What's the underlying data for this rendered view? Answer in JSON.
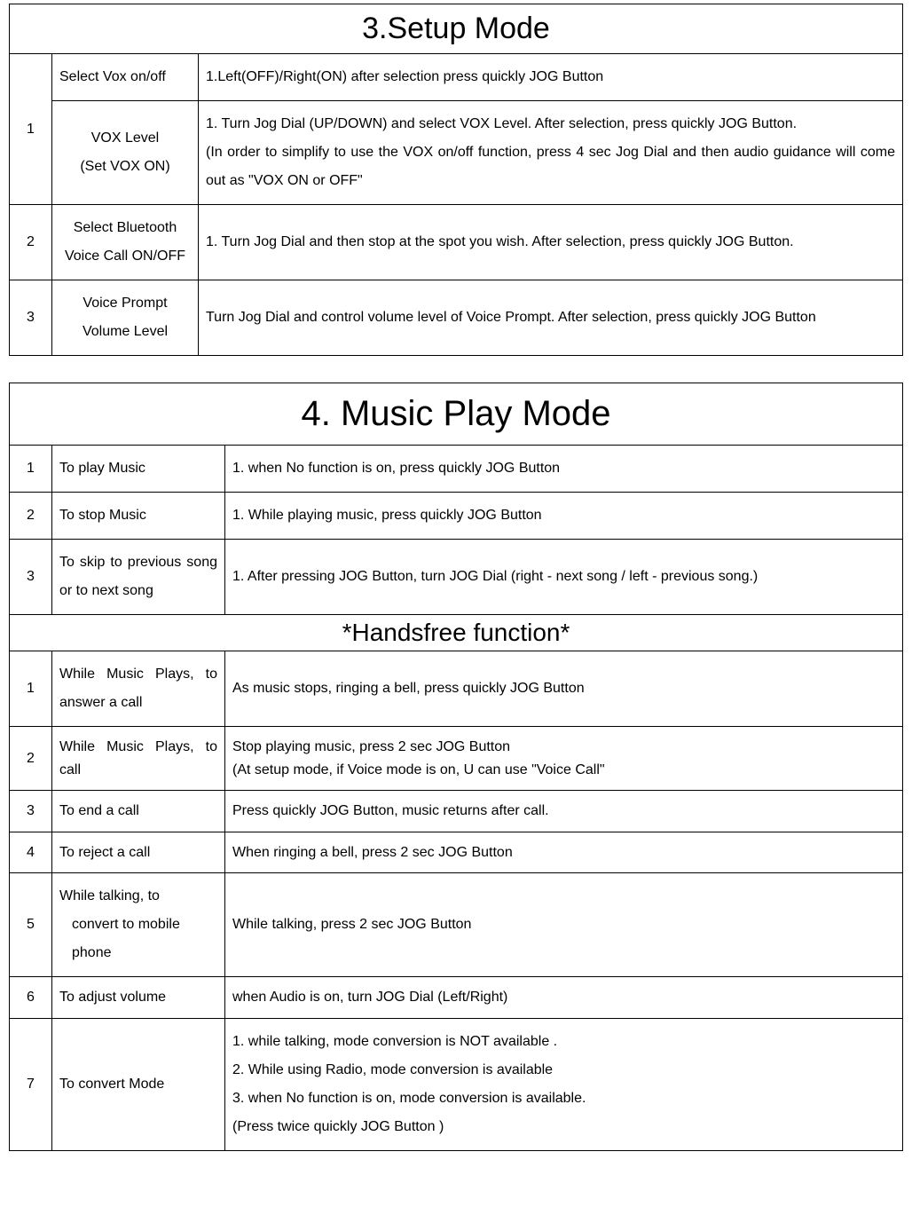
{
  "section3": {
    "title": "3.Setup Mode",
    "rows": [
      {
        "num": "1",
        "func1": "Select Vox on/off",
        "desc1": "1.Left(OFF)/Right(ON) after selection press quickly JOG Button",
        "func2_line1": "VOX Level",
        "func2_line2": "(Set VOX ON)",
        "desc2_line1": "1. Turn Jog Dial (UP/DOWN) and select VOX Level. After selection, press quickly JOG Button.",
        "desc2_line2": "(In order to simplify to use the VOX on/off function, press 4 sec Jog Dial and then audio guidance will come out as \"VOX ON or OFF\""
      },
      {
        "num": "2",
        "func_line1": "Select Bluetooth",
        "func_line2": "Voice Call ON/OFF",
        "desc": "1. Turn Jog Dial and then stop at the spot you wish. After selection, press quickly JOG Button."
      },
      {
        "num": "3",
        "func_line1": "Voice Prompt",
        "func_line2": "Volume Level",
        "desc": "Turn Jog Dial and control volume level of Voice Prompt. After selection, press quickly JOG Button"
      }
    ]
  },
  "section4": {
    "title": "4. Music Play Mode",
    "rows": [
      {
        "num": "1",
        "func": "To play Music",
        "desc": "1. when No function is on, press quickly JOG Button"
      },
      {
        "num": "2",
        "func": "To stop Music",
        "desc": "1. While playing music, press quickly JOG Button"
      },
      {
        "num": "3",
        "func": "To skip to previous song or to next song",
        "desc": "1. After pressing JOG Button, turn JOG Dial (right - next song / left - previous song.)"
      }
    ],
    "handsfree_title": "*Handsfree function*",
    "hf_rows": [
      {
        "num": "1",
        "func": "While Music Plays, to answer a call",
        "desc": "As music stops, ringing a bell, press quickly JOG Button"
      },
      {
        "num": "2",
        "func": "While Music Plays, to call",
        "desc_line1": "Stop playing music, press 2 sec JOG Button",
        "desc_line2": "(At setup mode, if Voice mode is on, U can use \"Voice Call\""
      },
      {
        "num": "3",
        "func": "To end a call",
        "desc": "Press quickly JOG Button, music returns after call."
      },
      {
        "num": "4",
        "func": "To reject a call",
        "desc": "When ringing a bell, press 2 sec JOG Button"
      },
      {
        "num": "5",
        "func_line1": "While talking, to",
        "func_line2": "convert to mobile",
        "func_line3": "phone",
        "desc": "While talking, press 2 sec JOG Button"
      },
      {
        "num": "6",
        "func": "To adjust volume",
        "desc": "when Audio is on, turn JOG Dial (Left/Right)"
      },
      {
        "num": "7",
        "func": "To convert Mode",
        "desc_line1": "1. while talking, mode conversion is NOT available .",
        "desc_line2": "2. While using Radio, mode conversion is available",
        "desc_line3": "3. when No function is on, mode conversion is available.",
        "desc_line4": "(Press twice quickly JOG Button )"
      }
    ]
  }
}
